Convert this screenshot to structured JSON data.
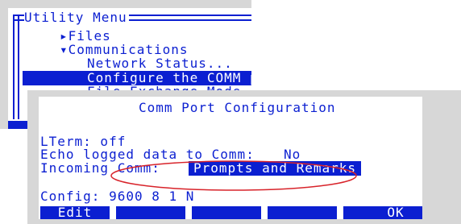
{
  "menu": {
    "title": "Utility Menu",
    "items": [
      {
        "label": "▸Files"
      },
      {
        "label": "▾Communications"
      },
      {
        "label": "Network Status..."
      },
      {
        "label": "Configure the COMM port..."
      },
      {
        "label": "File Exchange Mode"
      }
    ],
    "selected_index": 3
  },
  "dialog": {
    "title": "Comm Port Configuration",
    "lterm": "LTerm: off",
    "echo_label": "Echo logged data to Comm:",
    "echo_value": "No",
    "incoming_label": "Incoming Comm:",
    "incoming_value": "Prompts and Remarks",
    "config_line": "Config: 9600 8 1 N"
  },
  "function_keys": [
    "Edit",
    "",
    "",
    "",
    "",
    "OK"
  ],
  "colors": {
    "screen_blue": "#0b1fd1",
    "annotation_red": "#d8232a",
    "window_gray": "#d7d7d7"
  }
}
